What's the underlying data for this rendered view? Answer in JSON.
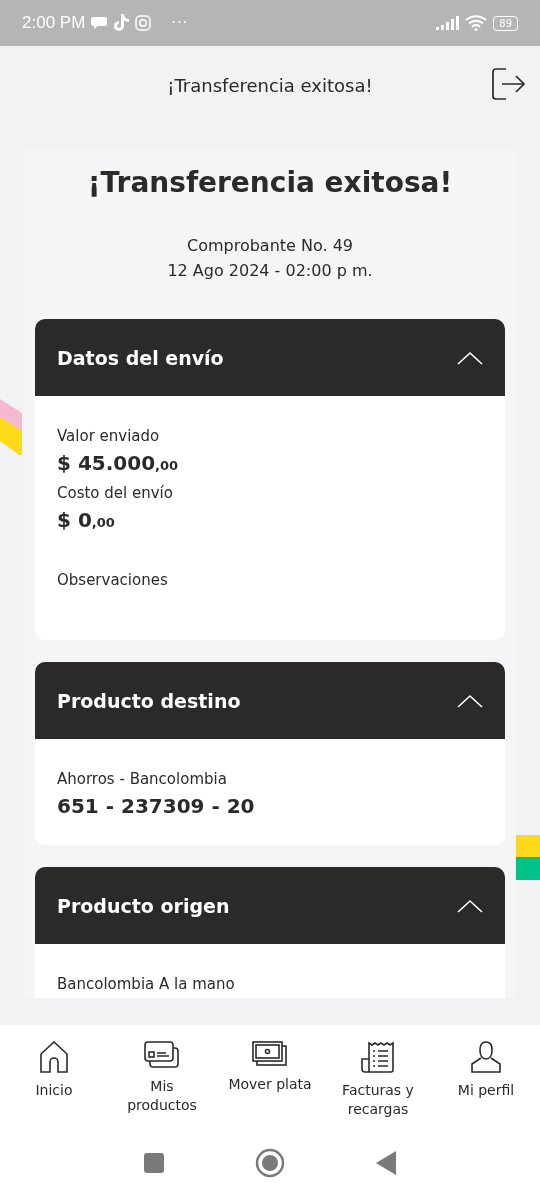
{
  "status_bar": {
    "time": "2:00 PM",
    "more": "···",
    "battery": "89"
  },
  "header": {
    "title": "¡Transferencia exitosa!"
  },
  "receipt": {
    "title": "¡Transferencia exitosa!",
    "number": "Comprobante No. 49",
    "date": "12 Ago 2024 - 02:00 p m."
  },
  "sections": [
    {
      "title": "Datos del envío",
      "expanded": true,
      "fields": [
        {
          "kind": "label",
          "text": "Valor enviado"
        },
        {
          "kind": "amount",
          "main": "$ 45.000",
          "cents": ",00"
        },
        {
          "kind": "label",
          "text": "Costo del envío"
        },
        {
          "kind": "amount",
          "main": "$ 0",
          "cents": ",00"
        },
        {
          "kind": "spaced_label",
          "text": "Observaciones"
        }
      ]
    },
    {
      "title": "Producto destino",
      "expanded": true,
      "fields": [
        {
          "kind": "label",
          "text": "Ahorros - Bancolombia"
        },
        {
          "kind": "value",
          "text": "651 - 237309 - 20"
        }
      ]
    },
    {
      "title": "Producto origen",
      "expanded": true,
      "fields": [
        {
          "kind": "label",
          "text": "Bancolombia A la mano"
        }
      ]
    }
  ],
  "bottom_nav": [
    {
      "kind": "home",
      "label": "Inicio"
    },
    {
      "kind": "cards",
      "label": "Mis productos"
    },
    {
      "kind": "money",
      "label": "Mover plata"
    },
    {
      "kind": "receipt",
      "label": "Facturas y recargas"
    },
    {
      "kind": "profile",
      "label": "Mi perfil"
    }
  ]
}
